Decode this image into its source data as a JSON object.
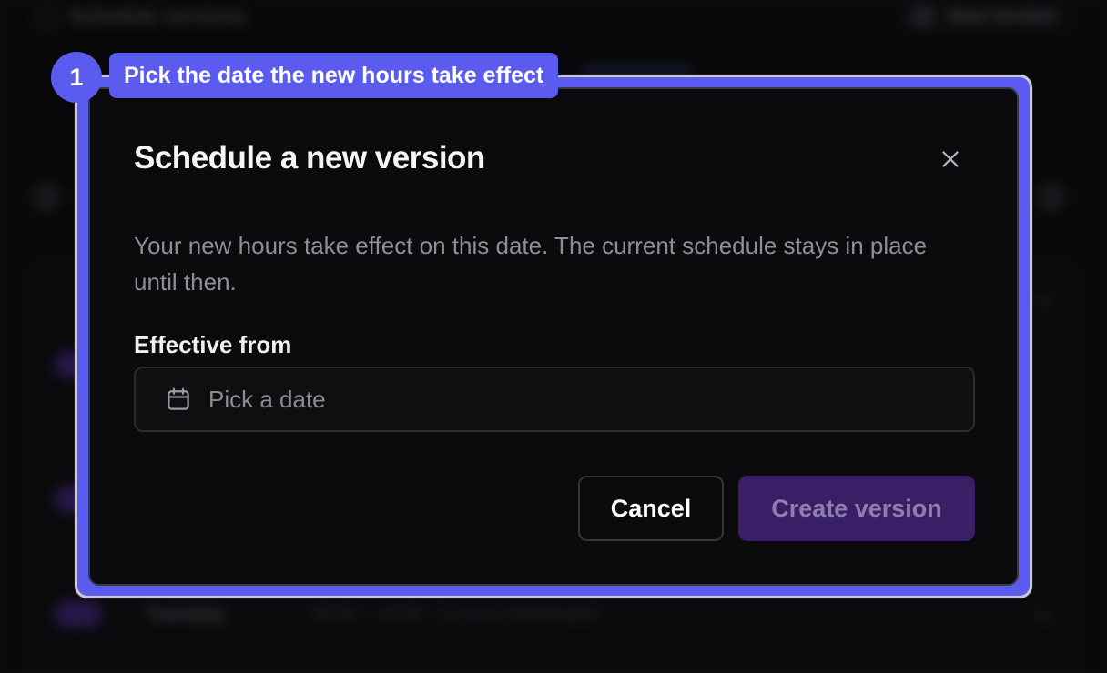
{
  "background": {
    "title": "Schedule versions",
    "new_button_label": "New version",
    "rows": [
      {
        "day": "Tuesday",
        "hours": "09:00 – 18:00 · 9 hours (Workhope)"
      }
    ]
  },
  "tutorial_step": {
    "number": "1",
    "label": "Pick the date the new hours take effect"
  },
  "dialog": {
    "title": "Schedule a new version",
    "description": "Your new hours take effect on this date. The current schedule stays in place until then.",
    "field": {
      "label": "Effective from",
      "placeholder": "Pick a date",
      "icon": "calendar-icon"
    },
    "buttons": {
      "cancel": "Cancel",
      "create": "Create version"
    },
    "close_icon": "close-icon"
  },
  "colors": {
    "accent": "#5b5bf0",
    "dialog_bg": "#0b0b0d",
    "primary_disabled": "#3a1f66"
  }
}
